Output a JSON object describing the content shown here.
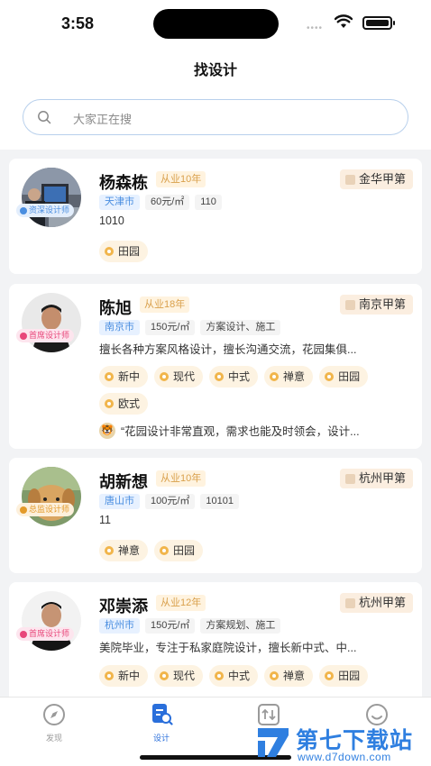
{
  "status": {
    "time": "3:58",
    "signal": "••••"
  },
  "header": {
    "title": "找设计"
  },
  "search": {
    "placeholder": "大家正在搜"
  },
  "designers": [
    {
      "name": "杨森栋",
      "experience": "从业10年",
      "firm": "金华甲第",
      "role": "资深设计师",
      "role_color": "#4a8ee0",
      "city": "天津市",
      "price": "60元/㎡",
      "extra": "110",
      "desc": "1010",
      "tags": [
        "田园"
      ]
    },
    {
      "name": "陈旭",
      "experience": "从业18年",
      "firm": "南京甲第",
      "role": "首席设计师",
      "role_color": "#e8467a",
      "city": "南京市",
      "price": "150元/㎡",
      "extra": "方案设计、施工",
      "desc": "擅长各种方案风格设计，擅长沟通交流，花园集俱...",
      "tags": [
        "新中",
        "现代",
        "中式",
        "禅意",
        "田园",
        "欧式"
      ],
      "review": "“花园设计非常直观，需求也能及时领会，设计..."
    },
    {
      "name": "胡新想",
      "experience": "从业10年",
      "firm": "杭州甲第",
      "role": "总监设计师",
      "role_color": "#e39a2a",
      "city": "唐山市",
      "price": "100元/㎡",
      "extra": "10101",
      "desc": "11",
      "tags": [
        "禅意",
        "田园"
      ]
    },
    {
      "name": "邓崇添",
      "experience": "从业12年",
      "firm": "杭州甲第",
      "role": "首席设计师",
      "role_color": "#e8467a",
      "city": "杭州市",
      "price": "150元/㎡",
      "extra": "方案规划、施工",
      "desc": "美院毕业，专注于私家庭院设计，擅长新中式、中...",
      "tags": [
        "新中",
        "现代",
        "中式",
        "禅意",
        "田园"
      ]
    }
  ],
  "tabbar": {
    "items": [
      {
        "label": "发现",
        "icon": "compass-icon"
      },
      {
        "label": "设计",
        "icon": "design-search-icon"
      },
      {
        "label": "",
        "icon": "compare-icon"
      },
      {
        "label": "",
        "icon": "smile-icon"
      }
    ],
    "active_color": "#2a6fdb"
  },
  "watermark": {
    "title": "第七下载站",
    "url": "www.d7down.com"
  },
  "colors": {
    "accent": "#2a6fdb",
    "tag_bg": "#fdf3e2",
    "exp_text": "#d9a04c"
  }
}
